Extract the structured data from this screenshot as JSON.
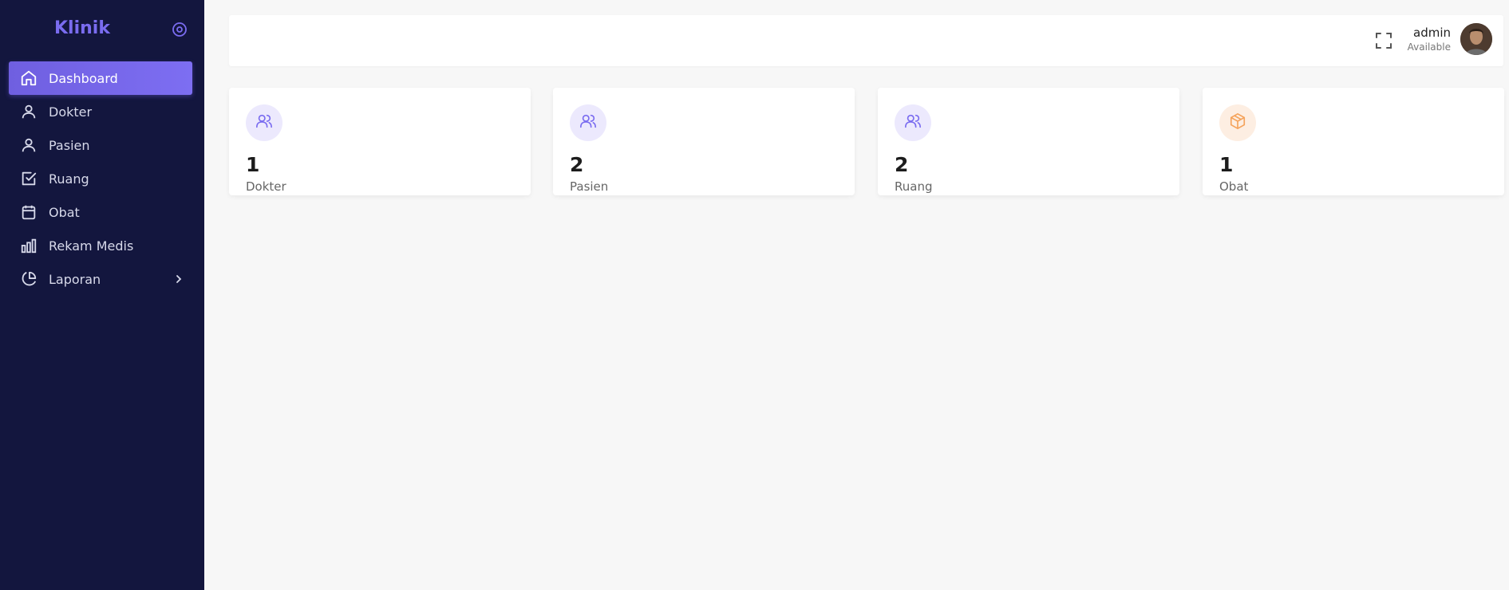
{
  "sidebar": {
    "brand": "Klinik",
    "items": [
      {
        "label": "Dashboard",
        "icon": "home-icon"
      },
      {
        "label": "Dokter",
        "icon": "user-icon"
      },
      {
        "label": "Pasien",
        "icon": "user-icon"
      },
      {
        "label": "Ruang",
        "icon": "check-square-icon"
      },
      {
        "label": "Obat",
        "icon": "calendar-icon"
      },
      {
        "label": "Rekam Medis",
        "icon": "bar-chart-icon"
      },
      {
        "label": "Laporan",
        "icon": "pie-chart-icon"
      }
    ]
  },
  "header": {
    "user_name": "admin",
    "user_status": "Available"
  },
  "cards": [
    {
      "count": "1",
      "label": "Dokter",
      "icon": "users-icon"
    },
    {
      "count": "2",
      "label": "Pasien",
      "icon": "users-icon"
    },
    {
      "count": "2",
      "label": "Ruang",
      "icon": "users-icon"
    },
    {
      "count": "1",
      "label": "Obat",
      "icon": "box-icon"
    }
  ],
  "colors": {
    "sidebar_bg": "#13163e",
    "accent": "#7a6cf0",
    "orange": "#f5a35b"
  }
}
